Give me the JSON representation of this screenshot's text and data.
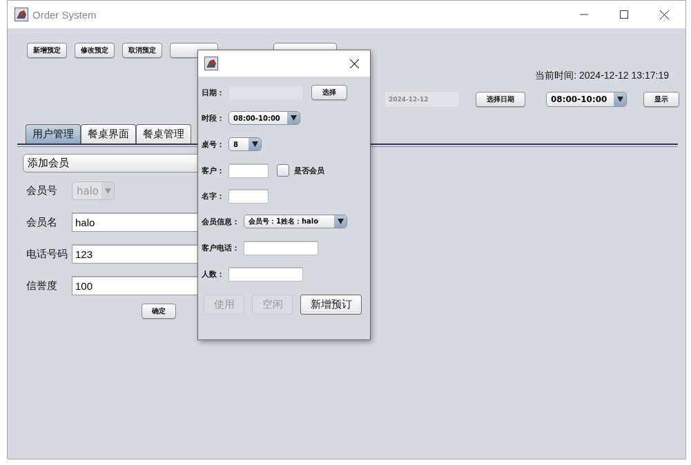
{
  "window": {
    "title": "Order System"
  },
  "toolbar": [
    {
      "label": "新增预定"
    },
    {
      "label": "修改预定"
    },
    {
      "label": "取消预定"
    },
    {
      "kind": "covered"
    },
    {
      "kind": "covered"
    }
  ],
  "current_time": "当前时间: 2024-12-12 13:17:19",
  "filter": {
    "date": "2024-12-12",
    "date_button": "选择日期",
    "slot": "08:00-10:00",
    "show_button": "显示"
  },
  "tabs": [
    {
      "label": "用户管理",
      "selected": true
    },
    {
      "label": "餐桌界面",
      "selected": false
    },
    {
      "label": "餐桌管理",
      "selected": false
    }
  ],
  "member_form": {
    "mode": "添加会员",
    "fields": [
      {
        "kind": "combo",
        "label": "会员号",
        "value": "halo",
        "disabled": true
      },
      {
        "kind": "text",
        "label": "会员名",
        "value": "halo"
      },
      {
        "kind": "text",
        "label": "电话号码",
        "value": "123"
      },
      {
        "kind": "text",
        "label": "信誉度",
        "value": "100"
      }
    ],
    "confirm": "确定"
  },
  "dialog": {
    "rows": [
      {
        "kind": "field-button",
        "label": "日期：",
        "button": "选择",
        "disabled": true
      },
      {
        "kind": "combo",
        "label": "时段：",
        "value": "08:00-10:00"
      },
      {
        "kind": "combo",
        "label": "桌号：",
        "value": "8"
      },
      {
        "kind": "field-check",
        "label": "客户：",
        "check_label": "是否会员",
        "checked": false
      },
      {
        "kind": "field",
        "label": "名字："
      },
      {
        "kind": "combo",
        "label": "会员信息：",
        "value": "会员号：1姓名：halo"
      },
      {
        "kind": "field",
        "label": "客户电话："
      },
      {
        "kind": "field",
        "label": "人数："
      }
    ],
    "buttons": [
      {
        "label": "使用",
        "disabled": true
      },
      {
        "label": "空闲",
        "disabled": true
      },
      {
        "label": "新增预订",
        "disabled": false
      }
    ]
  }
}
